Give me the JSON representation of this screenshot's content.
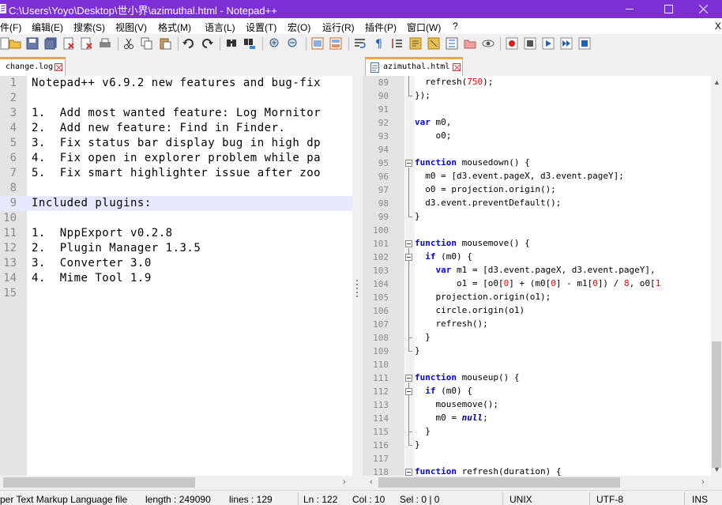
{
  "window": {
    "title": "C:\\Users\\Yoyo\\Desktop\\世小界\\azimuthal.html - Notepad++",
    "minimize_icon": "minimize-icon",
    "maximize_icon": "maximize-icon",
    "close_icon": "close-icon"
  },
  "menu": {
    "items": [
      "件(F)",
      "编辑(E)",
      "搜索(S)",
      "视图(V)",
      "格式(M)",
      "语言(L)",
      "设置(T)",
      "宏(O)",
      "运行(R)",
      "插件(P)",
      "窗口(W)",
      "?"
    ],
    "close_label": "X"
  },
  "toolbar": {
    "icons": [
      "new-file-icon",
      "open-file-icon",
      "save-icon",
      "save-all-icon",
      "close-icon",
      "close-all-icon",
      "print-icon",
      "cut-icon",
      "copy-icon",
      "paste-icon",
      "undo-icon",
      "redo-icon",
      "find-icon",
      "replace-icon",
      "zoom-in-icon",
      "zoom-out-icon",
      "sync-vertical-icon",
      "sync-horizontal-icon",
      "word-wrap-icon",
      "show-all-chars-icon",
      "indent-guide-icon",
      "document-map-icon",
      "function-list-icon",
      "folder-workspace-icon",
      "monitoring-icon",
      "record-macro-icon",
      "stop-record-icon",
      "play-macro-icon",
      "run-macro-multiple-icon",
      "save-macro-icon",
      "spellcheck-icon"
    ]
  },
  "left_tab": {
    "label": "change.log"
  },
  "right_tab": {
    "label": "azimuthal.html"
  },
  "left_editor": {
    "lines": [
      {
        "n": "1",
        "text": "Notepad++ v6.9.2 new features and bug-fix"
      },
      {
        "n": "2",
        "text": ""
      },
      {
        "n": "3",
        "text": "1.  Add most wanted feature: Log Mornitor"
      },
      {
        "n": "4",
        "text": "2.  Add new feature: Find in Finder."
      },
      {
        "n": "5",
        "text": "3.  Fix status bar display bug in high dp"
      },
      {
        "n": "6",
        "text": "4.  Fix open in explorer problem while pa"
      },
      {
        "n": "7",
        "text": "5.  Fix smart highlighter issue after zoo"
      },
      {
        "n": "8",
        "text": ""
      },
      {
        "n": "9",
        "text": "Included plugins:"
      },
      {
        "n": "10",
        "text": ""
      },
      {
        "n": "11",
        "text": "1.  NppExport v0.2.8"
      },
      {
        "n": "12",
        "text": "2.  Plugin Manager 1.3.5"
      },
      {
        "n": "13",
        "text": "3.  Converter 3.0"
      },
      {
        "n": "14",
        "text": "4.  Mime Tool 1.9"
      },
      {
        "n": "15",
        "text": ""
      }
    ],
    "highlighted_line": 9
  },
  "right_editor": {
    "lines": [
      {
        "n": "89",
        "parts": [
          [
            "  refresh(",
            ""
          ],
          [
            "750",
            "num"
          ],
          [
            ");",
            ""
          ]
        ]
      },
      {
        "n": "90",
        "parts": [
          [
            "});",
            ""
          ]
        ]
      },
      {
        "n": "91",
        "parts": [
          [
            "",
            ""
          ]
        ]
      },
      {
        "n": "92",
        "parts": [
          [
            "var",
            "kw"
          ],
          [
            " m0,",
            ""
          ]
        ]
      },
      {
        "n": "93",
        "parts": [
          [
            "    o0;",
            ""
          ]
        ]
      },
      {
        "n": "94",
        "parts": [
          [
            "",
            ""
          ]
        ]
      },
      {
        "n": "95",
        "parts": [
          [
            "function",
            "kw"
          ],
          [
            " mousedown() {",
            ""
          ]
        ]
      },
      {
        "n": "96",
        "parts": [
          [
            "  m0 = [d3.event.pageX, d3.event.pageY];",
            ""
          ]
        ]
      },
      {
        "n": "97",
        "parts": [
          [
            "  o0 = projection.origin();",
            ""
          ]
        ]
      },
      {
        "n": "98",
        "parts": [
          [
            "  d3.event.preventDefault();",
            ""
          ]
        ]
      },
      {
        "n": "99",
        "parts": [
          [
            "}",
            ""
          ]
        ]
      },
      {
        "n": "100",
        "parts": [
          [
            "",
            ""
          ]
        ]
      },
      {
        "n": "101",
        "parts": [
          [
            "function",
            "kw"
          ],
          [
            " mousemove() {",
            ""
          ]
        ]
      },
      {
        "n": "102",
        "parts": [
          [
            "  ",
            ""
          ],
          [
            "if",
            "kw"
          ],
          [
            " (m0) {",
            ""
          ]
        ]
      },
      {
        "n": "103",
        "parts": [
          [
            "    ",
            ""
          ],
          [
            "var",
            "kw"
          ],
          [
            " m1 = [d3.event.pageX, d3.event.pageY],",
            ""
          ]
        ]
      },
      {
        "n": "104",
        "parts": [
          [
            "        o1 = [o0[",
            ""
          ],
          [
            "0",
            "num"
          ],
          [
            "] + (m0[",
            ""
          ],
          [
            "0",
            "num"
          ],
          [
            "] - m1[",
            ""
          ],
          [
            "0",
            "num"
          ],
          [
            "]) / ",
            ""
          ],
          [
            "8",
            "num"
          ],
          [
            ", o0[",
            ""
          ],
          [
            "1",
            "num"
          ]
        ]
      },
      {
        "n": "105",
        "parts": [
          [
            "    projection.origin(o1);",
            ""
          ]
        ]
      },
      {
        "n": "106",
        "parts": [
          [
            "    circle.origin(o1)",
            ""
          ]
        ]
      },
      {
        "n": "107",
        "parts": [
          [
            "    refresh();",
            ""
          ]
        ]
      },
      {
        "n": "108",
        "parts": [
          [
            "  }",
            ""
          ]
        ]
      },
      {
        "n": "109",
        "parts": [
          [
            "}",
            ""
          ]
        ]
      },
      {
        "n": "110",
        "parts": [
          [
            "",
            ""
          ]
        ]
      },
      {
        "n": "111",
        "parts": [
          [
            "function",
            "kw"
          ],
          [
            " mouseup() {",
            ""
          ]
        ]
      },
      {
        "n": "112",
        "parts": [
          [
            "  ",
            ""
          ],
          [
            "if",
            "kw"
          ],
          [
            " (m0) {",
            ""
          ]
        ]
      },
      {
        "n": "113",
        "parts": [
          [
            "    mousemove();",
            ""
          ]
        ]
      },
      {
        "n": "114",
        "parts": [
          [
            "    m0 = ",
            ""
          ],
          [
            "null",
            "kw2"
          ],
          [
            ";",
            ""
          ]
        ]
      },
      {
        "n": "115",
        "parts": [
          [
            "  }",
            ""
          ]
        ]
      },
      {
        "n": "116",
        "parts": [
          [
            "}",
            ""
          ]
        ]
      },
      {
        "n": "117",
        "parts": [
          [
            "",
            ""
          ]
        ]
      },
      {
        "n": "118",
        "parts": [
          [
            "function",
            "kw"
          ],
          [
            " refresh(duration) {",
            ""
          ]
        ]
      }
    ]
  },
  "statusbar": {
    "filetype": "per Text Markup Language file",
    "length": "length : 249090",
    "lines": "lines : 129",
    "ln": "Ln : 122",
    "col": "Col : 10",
    "sel": "Sel : 0 | 0",
    "eol": "UNIX",
    "encoding": "UTF-8",
    "mode": "INS"
  },
  "colors": {
    "titlebar": "#7b2fd4",
    "keyword": "#0000ff",
    "number": "#ff0000",
    "tab_accent": "#f9a33f",
    "line_highlight": "#e8e8ff"
  }
}
